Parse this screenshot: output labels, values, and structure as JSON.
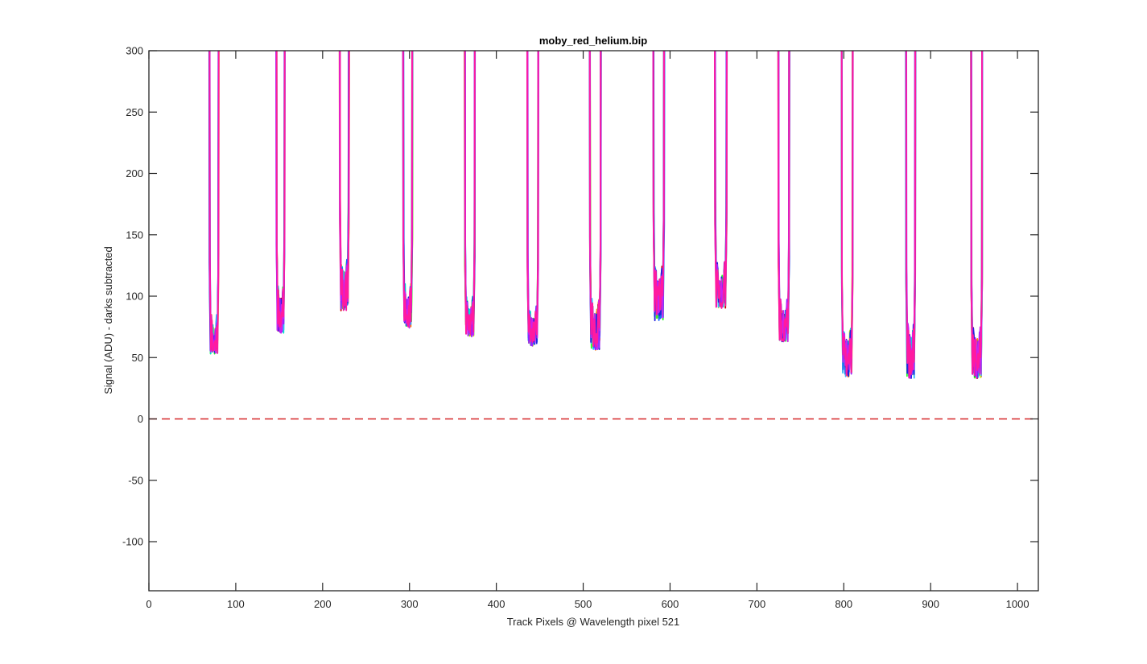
{
  "chart_data": {
    "type": "line",
    "title": "moby_red_helium.bip",
    "xlabel": "Track Pixels @ Wavelength pixel 521",
    "ylabel": "Signal (ADU) - darks subtracted",
    "xlim": [
      0,
      1024
    ],
    "ylim": [
      -140,
      300
    ],
    "xticks": [
      0,
      100,
      200,
      300,
      400,
      500,
      600,
      700,
      800,
      900,
      1000
    ],
    "yticks": [
      -100,
      -50,
      0,
      50,
      100,
      150,
      200,
      250,
      300
    ],
    "grid": false,
    "legend": "none",
    "reference_line": {
      "y": 0,
      "style": "dashed",
      "color": "#d62728"
    },
    "series_colors": [
      "#cc0000",
      "#ff8c00",
      "#c8e600",
      "#22ff22",
      "#00e6cc",
      "#33bbff",
      "#1a66ff",
      "#2222dd",
      "#9922ff",
      "#cc22ee",
      "#ff1aa0"
    ],
    "peaks": [
      {
        "left": 70,
        "right": 80,
        "min": 53,
        "base": 75
      },
      {
        "left": 147,
        "right": 156,
        "min": 70,
        "base": 98
      },
      {
        "left": 220,
        "right": 230,
        "min": 88,
        "base": 120
      },
      {
        "left": 293,
        "right": 303,
        "min": 74,
        "base": 100
      },
      {
        "left": 364,
        "right": 375,
        "min": 67,
        "base": 90
      },
      {
        "left": 436,
        "right": 448,
        "min": 59,
        "base": 82
      },
      {
        "left": 508,
        "right": 520,
        "min": 56,
        "base": 88
      },
      {
        "left": 581,
        "right": 593,
        "min": 80,
        "base": 115
      },
      {
        "left": 652,
        "right": 665,
        "min": 90,
        "base": 118
      },
      {
        "left": 725,
        "right": 737,
        "min": 63,
        "base": 88
      },
      {
        "left": 798,
        "right": 810,
        "min": 34,
        "base": 65
      },
      {
        "left": 872,
        "right": 882,
        "min": 33,
        "base": 68
      },
      {
        "left": 947,
        "right": 959,
        "min": 33,
        "base": 65
      }
    ]
  }
}
